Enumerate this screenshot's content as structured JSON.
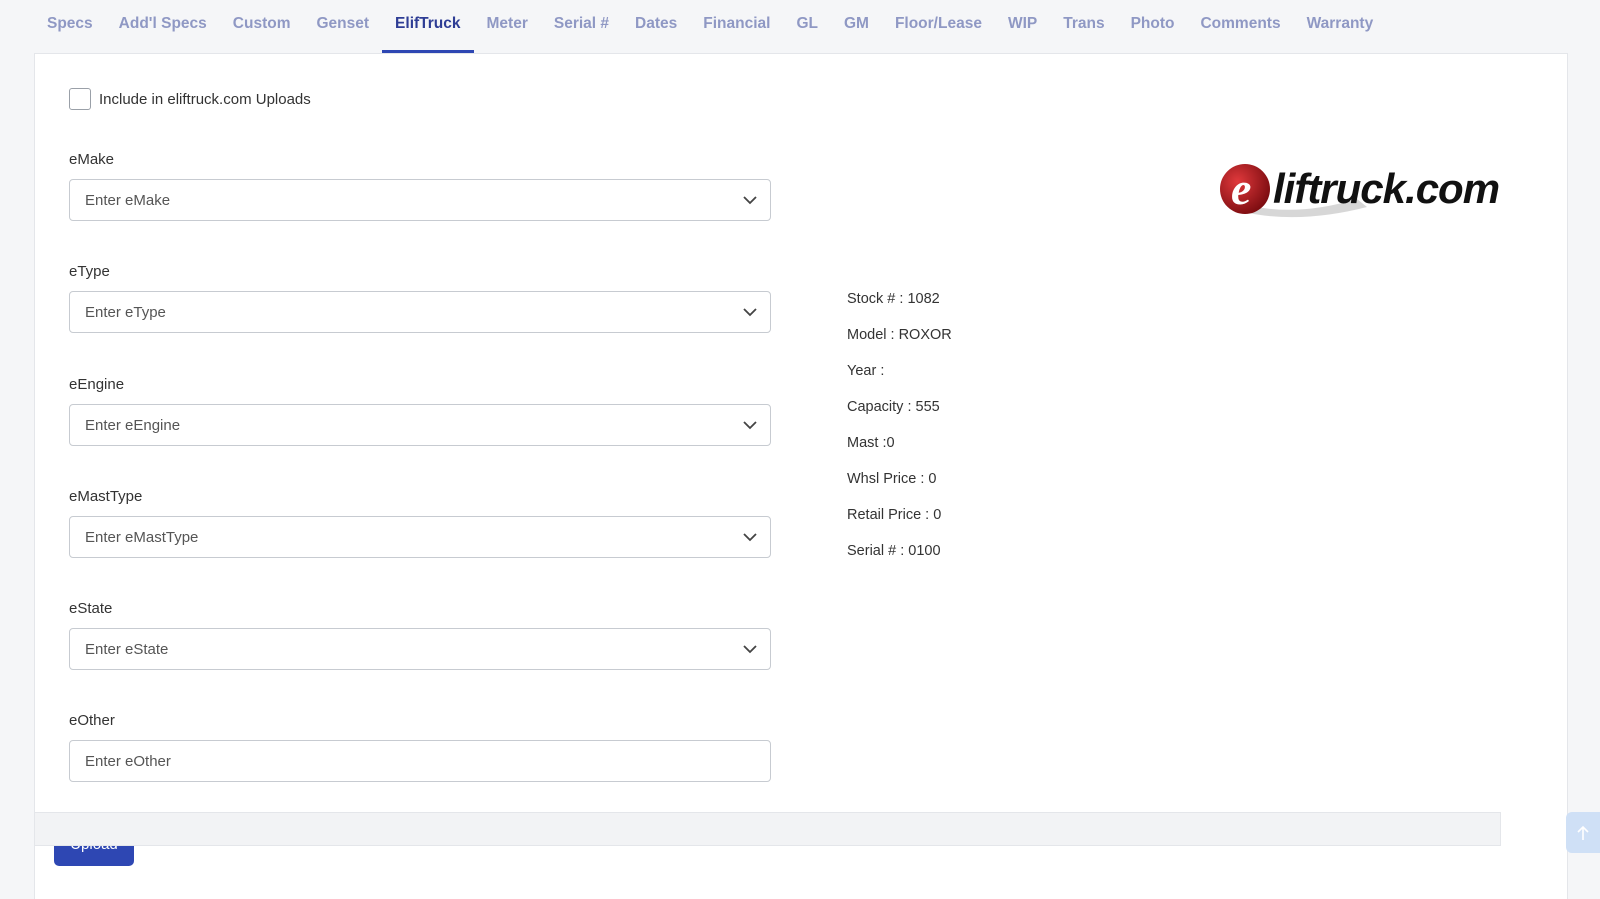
{
  "tabs": [
    {
      "label": "Specs"
    },
    {
      "label": "Add'l Specs"
    },
    {
      "label": "Custom"
    },
    {
      "label": "Genset"
    },
    {
      "label": "ElifTruck"
    },
    {
      "label": "Meter"
    },
    {
      "label": "Serial #"
    },
    {
      "label": "Dates"
    },
    {
      "label": "Financial"
    },
    {
      "label": "GL"
    },
    {
      "label": "GM"
    },
    {
      "label": "Floor/Lease"
    },
    {
      "label": "WIP"
    },
    {
      "label": "Trans"
    },
    {
      "label": "Photo"
    },
    {
      "label": "Comments"
    },
    {
      "label": "Warranty"
    }
  ],
  "active_tab": "ElifTruck",
  "include_upload": {
    "label": "Include in eliftruck.com Uploads",
    "checked": false
  },
  "fields": {
    "emake": {
      "label": "eMake",
      "placeholder": "Enter eMake"
    },
    "etype": {
      "label": "eType",
      "placeholder": "Enter eType"
    },
    "eengine": {
      "label": "eEngine",
      "placeholder": "Enter eEngine"
    },
    "emasttype": {
      "label": "eMastType",
      "placeholder": "Enter eMastType"
    },
    "estate": {
      "label": "eState",
      "placeholder": "Enter eState"
    },
    "eother": {
      "label": "eOther",
      "placeholder": "Enter eOther"
    }
  },
  "info": {
    "stock": "Stock # : 1082",
    "model": "Model : ROXOR",
    "year": "Year :",
    "capacity": "Capacity : 555",
    "mast": "Mast :0",
    "whsl_price": "Whsl Price : 0",
    "retail_price": "Retail Price : 0",
    "serial": "Serial # : 0100"
  },
  "logo": {
    "text_e": "e",
    "text_rest": "liftruck.com",
    "brand_red": "#c0171c",
    "brand_black": "#111111"
  },
  "upload_label": "Upload",
  "colors": {
    "accent": "#2e47b3",
    "tab_inactive": "#8f98c4",
    "tab_active": "#2e3d95"
  },
  "icons": {
    "select_caret": "chevron-down-icon",
    "scroll_top": "arrow-up-icon"
  }
}
